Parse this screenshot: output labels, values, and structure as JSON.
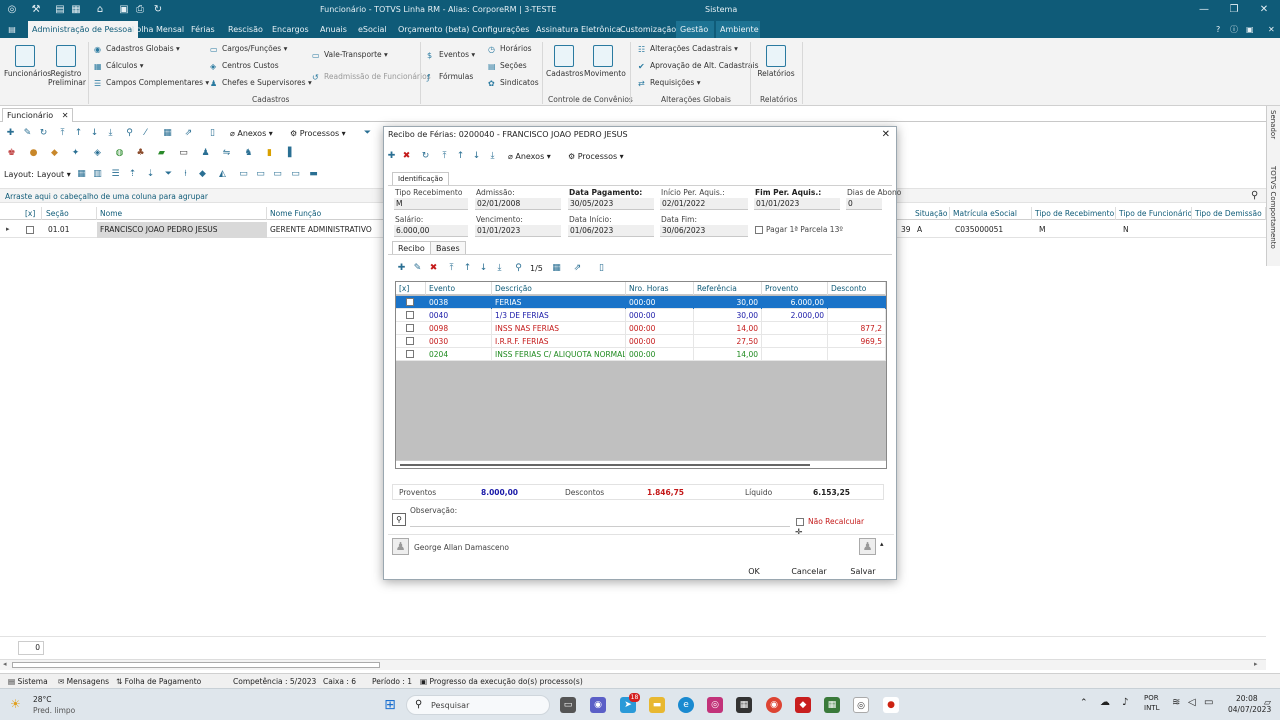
{
  "titlebar": {
    "title": "Funcionário - TOTVS Linha RM - Alias: CorporeRM | 3-TESTE",
    "system_label": "Sistema"
  },
  "menu": {
    "tabs": [
      "Administração de Pessoal",
      "Folha Mensal",
      "Férias",
      "Rescisão",
      "Encargos",
      "Anuais",
      "eSocial",
      "Orçamento (beta)",
      "Configurações",
      "Assinatura Eletrônica",
      "Customização",
      "Gestão",
      "Ambiente"
    ]
  },
  "ribbon": {
    "funcionarios": "Funcionários",
    "registro_preliminar": "Registro Preliminar",
    "cadastros_globais": "Cadastros Globais",
    "calculos": "Cálculos",
    "campos_complementares": "Campos Complementares",
    "cargos_funcoes": "Cargos/Funções",
    "centros_custos": "Centros Custos",
    "chefes_supervisores": "Chefes e Supervisores",
    "vale_transporte": "Vale-Transporte",
    "readmissao": "Readmissão de Funcionários",
    "eventos": "Eventos",
    "formulas": "Fórmulas",
    "horarios": "Horários",
    "secoes": "Seções",
    "sindicatos": "Sindicatos",
    "cadastros": "Cadastros",
    "movimento": "Movimento",
    "alteracoes_cadastrais": "Alterações Cadastrais",
    "aprovacao_alt": "Aprovação de Alt. Cadastrais",
    "requisicoes": "Requisições",
    "relatorios": "Relatórios",
    "group_cadastros": "Cadastros",
    "group_controle": "Controle de Convênios",
    "group_alteracoes": "Alterações Globais",
    "group_relatorios": "Relatórios"
  },
  "doc_tab": "Funcionário",
  "toolbar": {
    "anexos": "Anexos",
    "processos": "Processos",
    "layout": "Layout:",
    "layout_dd": "Layout"
  },
  "group_hint": "Arraste aqui o cabeçalho de uma coluna para agrupar",
  "grid": {
    "headers_left": [
      "[x]",
      "Seção",
      "Nome",
      "Nome Função"
    ],
    "headers_right": [
      "Situação",
      "Matrícula eSocial",
      "Tipo de Recebimento",
      "Tipo de Funcionário",
      "Tipo de Demissão"
    ],
    "row": {
      "secao": "01.01",
      "nome": "FRANCISCO JOAO PEDRO JESUS",
      "funcao": "GERENTE ADMINISTRATIVO",
      "num": "39",
      "situacao": "A",
      "matricula": "C035000051",
      "tipo_recebimento": "M",
      "tipo_funcionario": "N"
    }
  },
  "right_sidebar": [
    "Senador",
    "TOTVS Comportamento"
  ],
  "dialog": {
    "title": "Recibo de Férias: 0200040 - FRANCISCO JOAO PEDRO JESUS",
    "anexos": "Anexos",
    "processos": "Processos",
    "section_tab": "Identificação",
    "fields": {
      "tipo_recebimento_label": "Tipo Recebimento",
      "tipo_recebimento": "M",
      "admissao_label": "Admissão:",
      "admissao": "02/01/2008",
      "data_pagamento_label": "Data Pagamento:",
      "data_pagamento": "30/05/2023",
      "inicio_per_label": "Início Per. Aquis.:",
      "inicio_per": "02/01/2022",
      "fim_per_label": "Fim Per. Aquis.:",
      "fim_per": "01/01/2023",
      "dias_abono_label": "Dias de Abono",
      "dias_abono": "0",
      "salario_label": "Salário:",
      "salario": "6.000,00",
      "vencimento_label": "Vencimento:",
      "vencimento": "01/01/2023",
      "data_inicio_label": "Data Início:",
      "data_inicio": "01/06/2023",
      "data_fim_label": "Data Fim:",
      "data_fim": "30/06/2023",
      "pagar_parcela": "Pagar 1ª Parcela 13º"
    },
    "tabs": [
      "Recibo",
      "Bases"
    ],
    "pager": "1/5",
    "grid_headers": [
      "[x]",
      "Evento",
      "Descrição",
      "Nro. Horas",
      "Referência",
      "Provento",
      "Desconto"
    ],
    "rows": [
      {
        "evento": "0038",
        "descricao": "FERIAS",
        "horas": "000:00",
        "referencia": "30,00",
        "provento": "6.000,00",
        "desconto": "",
        "color": "#ffffff"
      },
      {
        "evento": "0040",
        "descricao": "1/3 DE FERIAS",
        "horas": "000:00",
        "referencia": "30,00",
        "provento": "2.000,00",
        "desconto": "",
        "color": "#1a1aa8"
      },
      {
        "evento": "0098",
        "descricao": "INSS NAS FERIAS",
        "horas": "000:00",
        "referencia": "14,00",
        "provento": "",
        "desconto": "877,2",
        "color": "#c41a1a"
      },
      {
        "evento": "0030",
        "descricao": "I.R.R.F. FERIAS",
        "horas": "000:00",
        "referencia": "27,50",
        "provento": "",
        "desconto": "969,5",
        "color": "#c41a1a"
      },
      {
        "evento": "0204",
        "descricao": "INSS FERIAS C/ ALIQUOTA NORMAL",
        "horas": "000:00",
        "referencia": "14,00",
        "provento": "",
        "desconto": "",
        "color": "#1f8a1f"
      }
    ],
    "totals": {
      "proventos_label": "Proventos",
      "proventos": "8.000,00",
      "descontos_label": "Descontos",
      "descontos": "1.846,75",
      "liquido_label": "Líquido",
      "liquido": "6.153,25"
    },
    "observacao_label": "Observação:",
    "nao_recalcular": "Não Recalcular",
    "user": "George Allan Damasceno",
    "ok": "OK",
    "cancelar": "Cancelar",
    "salvar": "Salvar"
  },
  "bottom": {
    "counter": "0"
  },
  "statusbar": {
    "sistema": "Sistema",
    "mensagens": "Mensagens",
    "folha": "Folha de Pagamento",
    "competencia": "Competência : 5/2023",
    "caixa": "Caixa : 6",
    "periodo": "Período : 1",
    "progresso": "Progresso da execução do(s) processo(s)"
  },
  "taskbar": {
    "temp": "28°C",
    "weather": "Pred. limpo",
    "search_placeholder": "Pesquisar",
    "lang1": "POR",
    "lang2": "INTL",
    "time": "20:08",
    "date": "04/07/2023",
    "badge": "18"
  }
}
